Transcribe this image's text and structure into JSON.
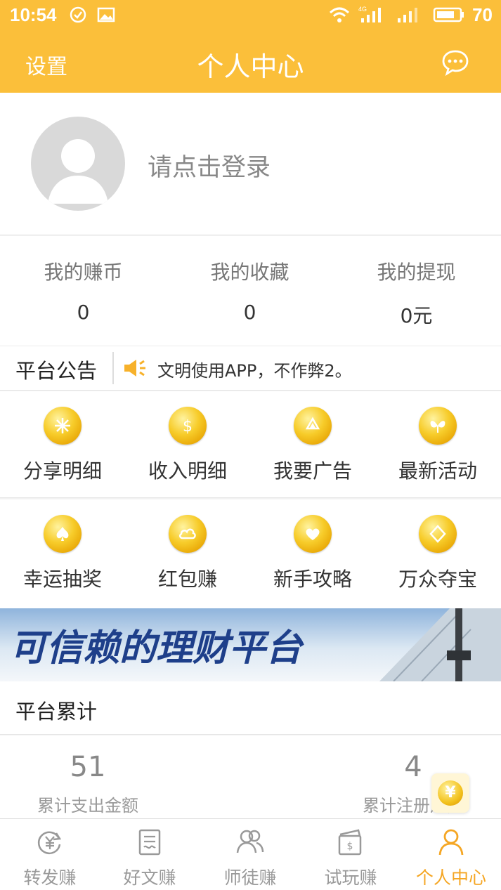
{
  "status_bar": {
    "time": "10:54",
    "battery": "70",
    "network": "4G"
  },
  "title_bar": {
    "left_label": "设置",
    "title": "个人中心"
  },
  "profile": {
    "login_prompt": "请点击登录"
  },
  "stats": [
    {
      "label": "我的赚币",
      "value": "0"
    },
    {
      "label": "我的收藏",
      "value": "0"
    },
    {
      "label": "我的提现",
      "value": "0元"
    }
  ],
  "notice": {
    "title": "平台公告",
    "text": "文明使用APP，不作弊2。"
  },
  "grid": {
    "row1": [
      {
        "label": "分享明细",
        "icon": "snowflake-coin-icon"
      },
      {
        "label": "收入明细",
        "icon": "dollar-coin-icon"
      },
      {
        "label": "我要广告",
        "icon": "recycle-coin-icon"
      },
      {
        "label": "最新活动",
        "icon": "butterfly-coin-icon"
      }
    ],
    "row2": [
      {
        "label": "幸运抽奖",
        "icon": "spade-coin-icon"
      },
      {
        "label": "红包赚",
        "icon": "cloud-coin-icon"
      },
      {
        "label": "新手攻略",
        "icon": "heart-coin-icon"
      },
      {
        "label": "万众夺宝",
        "icon": "diamond-coin-icon"
      }
    ]
  },
  "banner": {
    "text": "可信赖的理财平台"
  },
  "accumulation": {
    "title": "平台累计",
    "items": [
      {
        "value": "51",
        "label": "累计支出金额"
      },
      {
        "value": "4",
        "label": "累计注册用户"
      }
    ]
  },
  "float_coin": {
    "symbol": "¥"
  },
  "tabs": [
    {
      "label": "转发赚",
      "icon": "yuan-refresh-icon",
      "active": false
    },
    {
      "label": "好文赚",
      "icon": "document-icon",
      "active": false
    },
    {
      "label": "师徒赚",
      "icon": "users-icon",
      "active": false
    },
    {
      "label": "试玩赚",
      "icon": "wallet-icon",
      "active": false
    },
    {
      "label": "个人中心",
      "icon": "person-icon",
      "active": true
    }
  ],
  "colors": {
    "accent": "#fbbf3a",
    "active_tab": "#f5a623"
  }
}
